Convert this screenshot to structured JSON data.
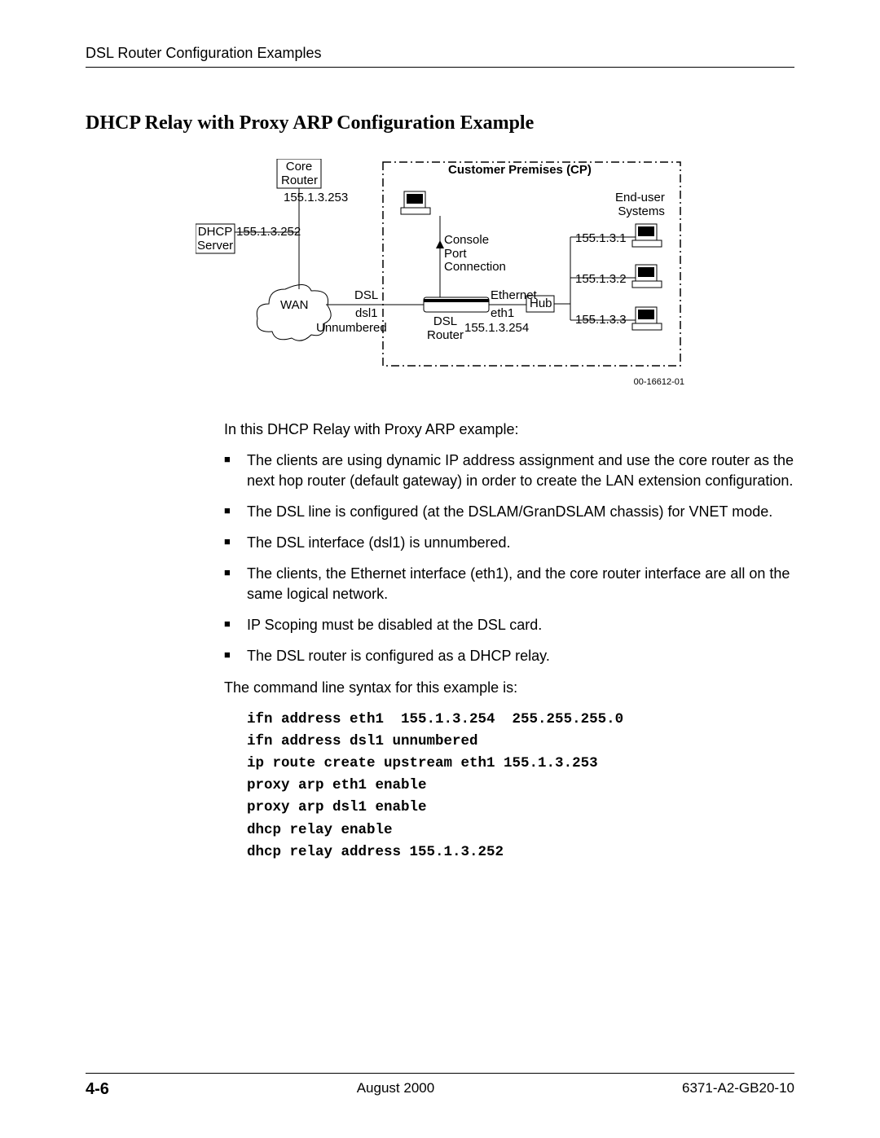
{
  "header": {
    "running": "DSL Router Configuration Examples"
  },
  "title": "DHCP Relay with Proxy ARP Configuration Example",
  "diagram": {
    "cp_title": "Customer Premises (CP)",
    "core_router": "Core\nRouter",
    "core_ip": "155.1.3.253",
    "dhcp_server": "DHCP\nServer",
    "dhcp_ip": "155.1.3.252",
    "wan": "WAN",
    "dsl": "DSL",
    "dsl1": "dsl1",
    "unnumbered": "Unnumbered",
    "dsl_router": "DSL\nRouter",
    "console": "Console\nPort\nConnection",
    "ethernet": "Ethernet",
    "eth1": "eth1",
    "eth_ip": "155.1.3.254",
    "hub": "Hub",
    "enduser": "End-user\nSystems",
    "ips": [
      "155.1.3.1",
      "155.1.3.2",
      "155.1.3.3"
    ],
    "id": "00-16612-01"
  },
  "intro": "In this DHCP Relay with Proxy ARP example:",
  "bullets": [
    "The clients are using dynamic IP address assignment and use the core router as the next hop router (default gateway) in order to create the LAN extension configuration.",
    "The DSL line is configured (at the DSLAM/GranDSLAM chassis) for VNET mode.",
    "The DSL interface (dsl1) is unnumbered.",
    "The clients, the Ethernet interface (eth1), and the core router interface are all on the same logical network.",
    "IP Scoping must be disabled at the DSL card.",
    "The DSL router is configured as a DHCP relay."
  ],
  "cmd_intro": "The command line syntax for this example is:",
  "commands": "ifn address eth1  155.1.3.254  255.255.255.0\nifn address dsl1 unnumbered\nip route create upstream eth1 155.1.3.253\nproxy arp eth1 enable\nproxy arp dsl1 enable\ndhcp relay enable\ndhcp relay address 155.1.3.252",
  "footer": {
    "page": "4-6",
    "date": "August 2000",
    "doc": "6371-A2-GB20-10"
  }
}
